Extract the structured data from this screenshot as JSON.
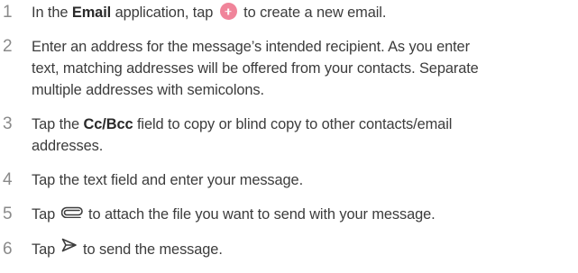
{
  "steps": [
    {
      "number": "1",
      "before": "In the ",
      "bold": "Email",
      "middle": " application, tap ",
      "icon": "plus-icon",
      "after": " to create a new email."
    },
    {
      "number": "2",
      "lines": [
        "Enter an address for the message’s intended recipient. As you enter",
        "text, matching addresses will be offered from your contacts. Separate",
        "multiple addresses with semicolons."
      ]
    },
    {
      "number": "3",
      "before": "Tap the ",
      "bold": "Cc/Bcc",
      "after_line1": " field to copy or blind copy to other contacts/email",
      "line2": "addresses."
    },
    {
      "number": "4",
      "text": "Tap the text field and enter your message."
    },
    {
      "number": "5",
      "before": "Tap ",
      "icon": "paperclip-icon",
      "after": " to attach the file you want to send with your message."
    },
    {
      "number": "6",
      "before": "Tap ",
      "icon": "send-icon",
      "after": " to send the message."
    }
  ],
  "colors": {
    "text": "#3c3c3c",
    "step_number": "#8a8a8a",
    "plus_icon_bg": "#f0849a"
  }
}
